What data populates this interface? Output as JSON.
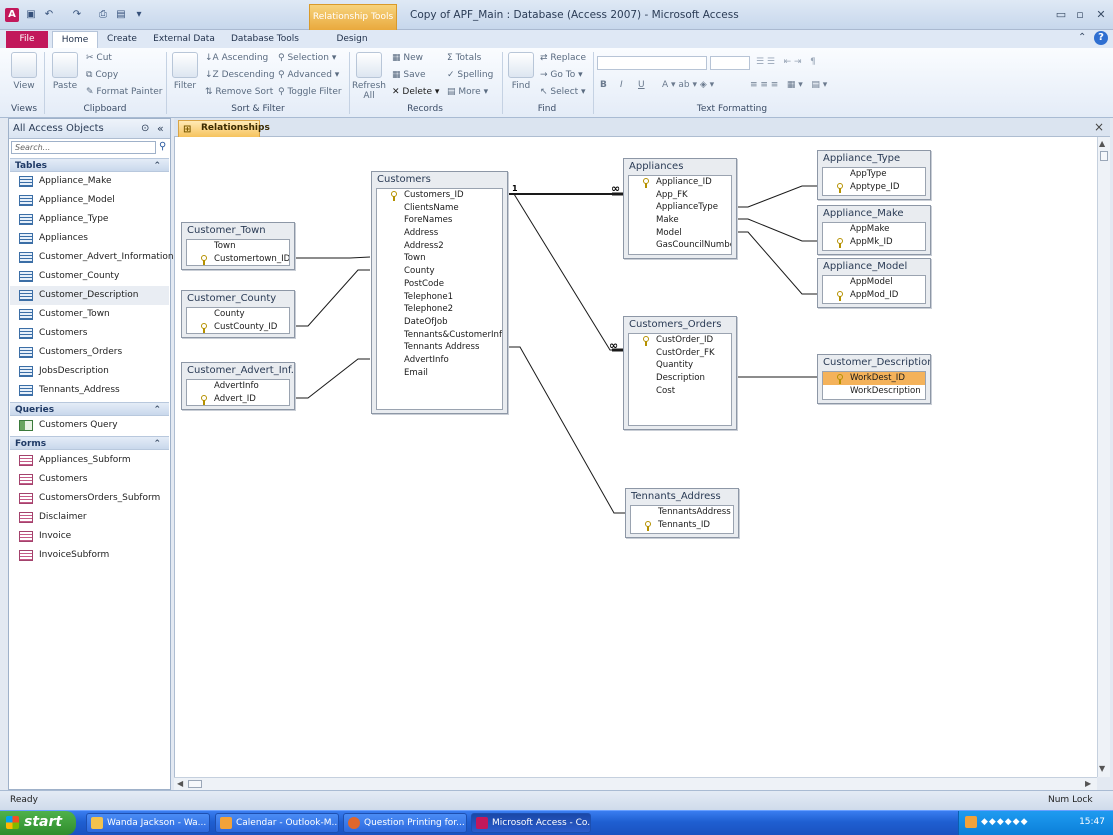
{
  "window": {
    "title": "Copy of APF_Main : Database (Access 2007)  -  Microsoft Access",
    "context_tab": "Relationship Tools"
  },
  "ribbon": {
    "tabs": [
      "File",
      "Home",
      "Create",
      "External Data",
      "Database Tools",
      "Design"
    ],
    "groups": {
      "views": {
        "label": "Views",
        "view": "View"
      },
      "clipboard": {
        "label": "Clipboard",
        "paste": "Paste",
        "cut": "Cut",
        "copy": "Copy",
        "format_painter": "Format Painter"
      },
      "sort_filter": {
        "label": "Sort & Filter",
        "filter": "Filter",
        "ascending": "Ascending",
        "descending": "Descending",
        "remove_sort": "Remove Sort",
        "selection": "Selection",
        "advanced": "Advanced",
        "toggle_filter": "Toggle Filter"
      },
      "records": {
        "label": "Records",
        "refresh": "Refresh",
        "refresh_all": "All",
        "new": "New",
        "save": "Save",
        "delete": "Delete",
        "totals": "Totals",
        "spelling": "Spelling",
        "more": "More"
      },
      "find": {
        "label": "Find",
        "find": "Find",
        "replace": "Replace",
        "goto": "Go To",
        "select": "Select"
      },
      "text_formatting": {
        "label": "Text Formatting"
      }
    }
  },
  "nav": {
    "header": "All Access Objects",
    "search_placeholder": "Search...",
    "sections": {
      "tables": {
        "label": "Tables",
        "items": [
          "Appliance_Make",
          "Appliance_Model",
          "Appliance_Type",
          "Appliances",
          "Customer_Advert_Information",
          "Customer_County",
          "Customer_Description",
          "Customer_Town",
          "Customers",
          "Customers_Orders",
          "JobsDescription",
          "Tennants_Address"
        ]
      },
      "queries": {
        "label": "Queries",
        "items": [
          "Customers Query"
        ]
      },
      "forms": {
        "label": "Forms",
        "items": [
          "Appliances_Subform",
          "Customers",
          "CustomersOrders_Subform",
          "Disclaimer",
          "Invoice",
          "InvoiceSubform"
        ]
      }
    }
  },
  "document": {
    "tab": "Relationships"
  },
  "tables": {
    "customers": {
      "title": "Customers",
      "fields": [
        "Customers_ID",
        "ClientsName",
        "ForeNames",
        "Address",
        "Address2",
        "Town",
        "County",
        "PostCode",
        "Telephone1",
        "Telephone2",
        "DateOfJob",
        "Tennants&CustomerInfo",
        "Tennants Address",
        "AdvertInfo",
        "Email"
      ]
    },
    "customer_town": {
      "title": "Customer_Town",
      "fields": [
        "Town",
        "Customertown_ID"
      ]
    },
    "customer_county": {
      "title": "Customer_County",
      "fields": [
        "County",
        "CustCounty_ID"
      ]
    },
    "customer_advert": {
      "title": "Customer_Advert_Inf...",
      "fields": [
        "AdvertInfo",
        "Advert_ID"
      ]
    },
    "appliances": {
      "title": "Appliances",
      "fields": [
        "Appliance_ID",
        "App_FK",
        "ApplianceType",
        "Make",
        "Model",
        "GasCouncilNumber"
      ]
    },
    "appliance_type": {
      "title": "Appliance_Type",
      "fields": [
        "AppType",
        "Apptype_ID"
      ]
    },
    "appliance_make": {
      "title": "Appliance_Make",
      "fields": [
        "AppMake",
        "AppMk_ID"
      ]
    },
    "appliance_model": {
      "title": "Appliance_Model",
      "fields": [
        "AppModel",
        "AppMod_ID"
      ]
    },
    "customers_orders": {
      "title": "Customers_Orders",
      "fields": [
        "CustOrder_ID",
        "CustOrder_FK",
        "Quantity",
        "Description",
        "Cost"
      ]
    },
    "customer_description": {
      "title": "Customer_Description",
      "fields": [
        "WorkDest_ID",
        "WorkDescription"
      ]
    },
    "tennants_address": {
      "title": "Tennants_Address",
      "fields": [
        "TennantsAddress",
        "Tennants_ID"
      ]
    }
  },
  "relationships": {
    "one": "1",
    "many": "∞"
  },
  "status": {
    "left": "Ready",
    "right": "Num Lock"
  },
  "taskbar": {
    "start": "start",
    "tasks": [
      "Wanda Jackson - Wa...",
      "Calendar - Outlook-M...",
      "Question Printing for...",
      "Microsoft Access - Co..."
    ],
    "clock": "15:47"
  }
}
